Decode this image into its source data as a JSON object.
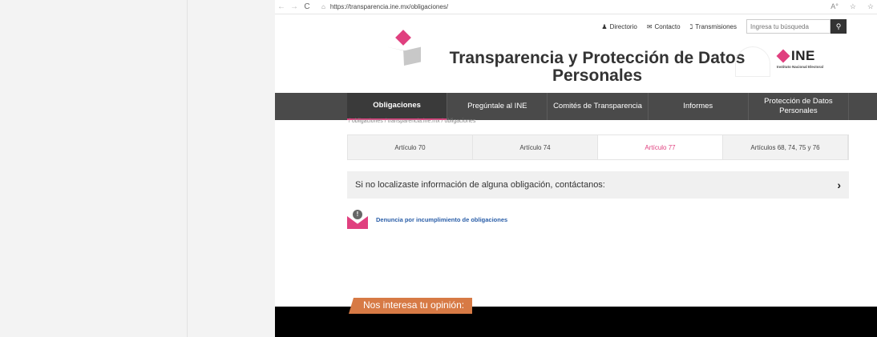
{
  "browser": {
    "back": "←",
    "forward": "→",
    "reload": "C",
    "lock": "🔒",
    "url": "https://transparencia.ine.mx/obligaciones/",
    "right_icons": [
      "A°",
      "☆",
      "☆"
    ]
  },
  "topbar": {
    "directorio": "Directorio",
    "contacto": "Contacto",
    "transmisiones": "Transmisiones",
    "search_placeholder": "Ingresa tu búsqueda",
    "search_icon": "🔍"
  },
  "header": {
    "title": "Transparencia y Protección de Datos Personales",
    "ine_logo_text": "INE",
    "ine_logo_sub": "Instituto Nacional Electoral"
  },
  "nav": {
    "items": [
      {
        "label": "Obligaciones"
      },
      {
        "label": "Pregúntale al INE"
      },
      {
        "label": "Comités de Transparencia"
      },
      {
        "label": "Informes"
      },
      {
        "label": "Protección de Datos Personales"
      }
    ]
  },
  "breadcrumb": "/ obligaciones / transparencia.ine.mx / obligaciones",
  "tabs": [
    {
      "label": "Artículo 70"
    },
    {
      "label": "Artículo 74"
    },
    {
      "label": "Artículo 77"
    },
    {
      "label": "Artículos 68, 74, 75 y 76"
    }
  ],
  "contact_bar": {
    "text": "Si no localizaste información de alguna obligación, contáctanos:",
    "chevron": "›"
  },
  "denuncia": {
    "label": "Denuncia por incumplimiento de obligaciones",
    "icon_glyph": "!"
  },
  "footer": {
    "opinion": "Nos interesa tu opinión:"
  },
  "colors": {
    "accent": "#e0407f",
    "nav_bg": "#4a4a4a",
    "opinion_tab": "#d77a45"
  }
}
